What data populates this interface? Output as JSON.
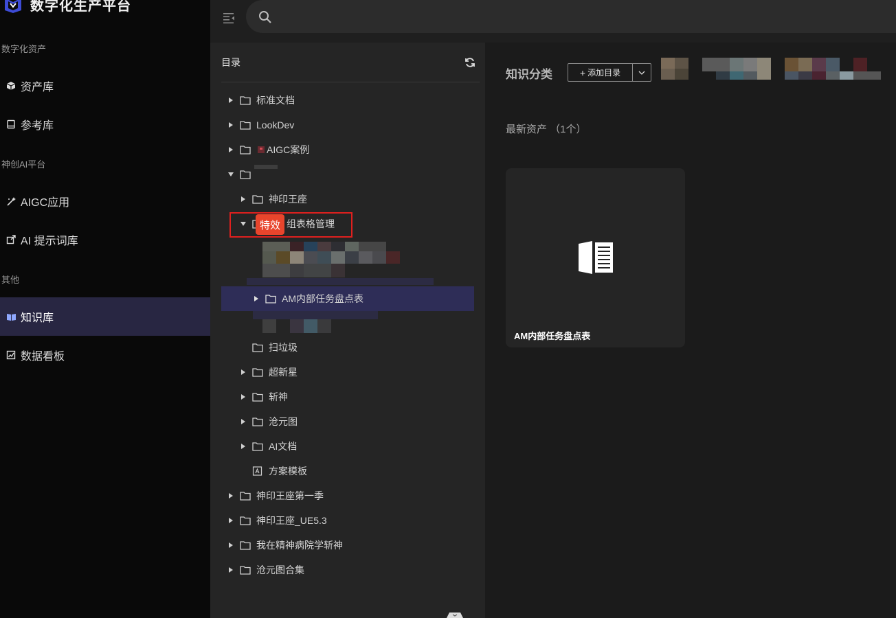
{
  "brand": {
    "title": "数字化生产平台"
  },
  "sidebar": {
    "groups": [
      "数字化资产",
      "神创AI平台",
      "其他"
    ],
    "items": [
      {
        "label": "资产库",
        "icon": "cube-icon"
      },
      {
        "label": "参考库",
        "icon": "book-icon"
      },
      {
        "label": "AIGC应用",
        "icon": "magic-wand-icon"
      },
      {
        "label": "AI 提示词库",
        "icon": "export-icon"
      },
      {
        "label": "知识库",
        "icon": "open-book-icon",
        "active": true
      },
      {
        "label": "数据看板",
        "icon": "chart-icon"
      }
    ]
  },
  "search": {
    "placeholder": ""
  },
  "directory": {
    "title": "目录",
    "tree": [
      {
        "label": "标准文档"
      },
      {
        "label": "LookDev"
      },
      {
        "label": "AIGC案例"
      },
      {
        "label": ""
      },
      {
        "label": "神印王座"
      },
      {
        "label": "组表格管理",
        "badge": "特效"
      },
      {
        "label": "AM内部任务盘点表"
      },
      {
        "label": "扫垃圾"
      },
      {
        "label": "超新星"
      },
      {
        "label": "斩神"
      },
      {
        "label": "沧元图"
      },
      {
        "label": "AI文档"
      },
      {
        "label": "方案模板"
      },
      {
        "label": "神印王座第一季"
      },
      {
        "label": "神印王座_UE5.3"
      },
      {
        "label": "我在精神病院学斩神"
      },
      {
        "label": "沧元图合集"
      }
    ]
  },
  "main": {
    "category_title": "知识分类",
    "add_dir_label": "添加目录",
    "latest_title": "最新资产 （1个）",
    "asset_card": {
      "name": "AM内部任务盘点表",
      "icon": "document-icon"
    }
  },
  "colors": {
    "accent": "#2e2d57",
    "highlight_box": "#e0201e",
    "badge": "#e8452c"
  }
}
